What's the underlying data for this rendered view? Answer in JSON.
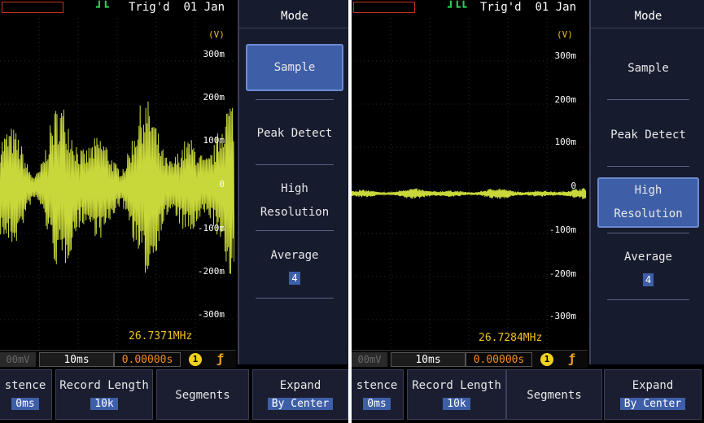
{
  "left": {
    "trigger_symbol": "┛┗",
    "trigger_status": "Trig'd",
    "date": "01 Jan",
    "volts_unit": "(V)",
    "y_ticks": [
      "300m",
      "200m",
      "100m",
      "0",
      "-100m",
      "-200m",
      "-300m"
    ],
    "frequency": "26.7371MHz",
    "status": {
      "volt_div": "00mV",
      "time_div": "10ms",
      "position": "0.00000s",
      "channel": "1"
    },
    "menu": {
      "title": "Mode",
      "options": [
        "Sample",
        "Peak Detect",
        "High",
        "Resolution",
        "Average"
      ],
      "average_value": "4",
      "selected": "Sample"
    },
    "bottom": {
      "persistence_label": "stence",
      "persistence_value": "0ms",
      "record_length_label": "Record Length",
      "record_length_value": "10k",
      "segments_label": "Segments",
      "expand_label": "Expand",
      "expand_value": "By Center"
    }
  },
  "right": {
    "trigger_symbol": "┛┗┗",
    "trigger_status": "Trig'd",
    "date": "01 Jan",
    "volts_unit": "(V)",
    "y_ticks": [
      "300m",
      "200m",
      "100m",
      "0",
      "-100m",
      "-200m",
      "-300m"
    ],
    "frequency": "26.7284MHz",
    "status": {
      "volt_div": "00mV",
      "time_div": "10ms",
      "position": "0.00000s",
      "channel": "1"
    },
    "menu": {
      "title": "Mode",
      "options": [
        "Sample",
        "Peak Detect",
        "High",
        "Resolution",
        "Average"
      ],
      "average_value": "4",
      "selected": "High Resolution"
    },
    "bottom": {
      "persistence_label": "stence",
      "persistence_value": "0ms",
      "record_length_label": "Record Length",
      "record_length_value": "10k",
      "segments_label": "Segments",
      "expand_label": "Expand",
      "expand_value": "By Center"
    }
  },
  "colors": {
    "trace": "#c8d83a",
    "menu_bg": "#171b2e",
    "selected": "#3e5fa8",
    "freq_text": "#f0c020"
  }
}
